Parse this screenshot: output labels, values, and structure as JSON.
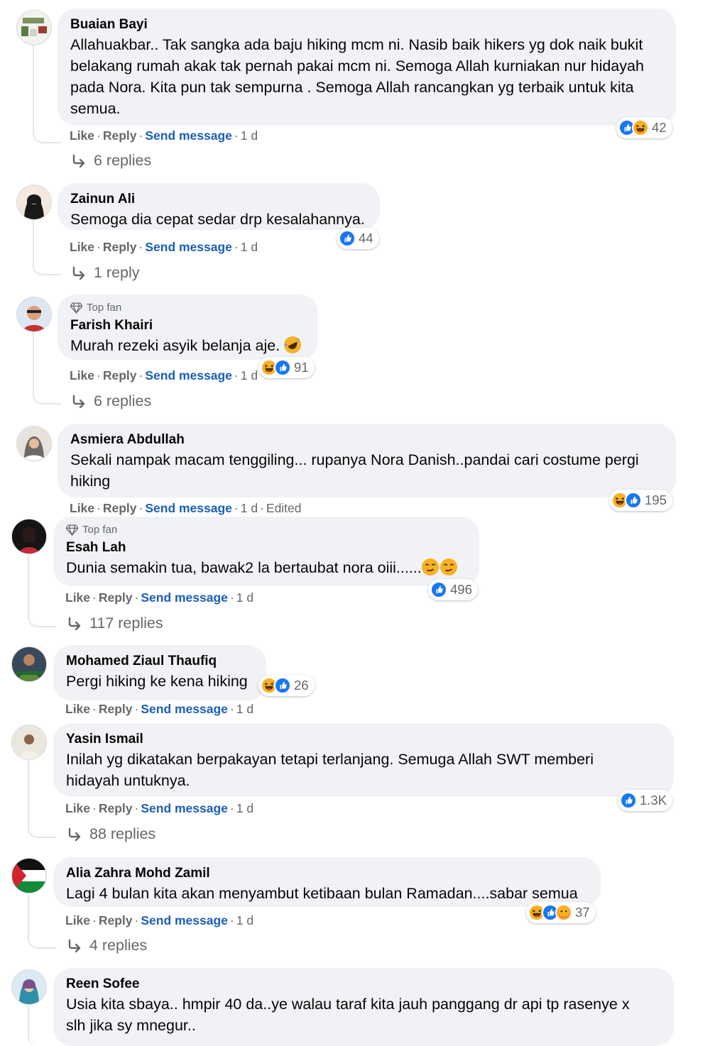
{
  "comments": [
    {
      "author": "Buaian Bayi",
      "top_fan": false,
      "text_lines": [
        "Allahuakbar.. Tak sangka ada baju hiking mcm ni. Nasib baik hikers yg dok naik bukit",
        "belakang rumah akak tak pernah pakai mcm ni. Semoga Allah kurniakan nur hidayah",
        "pada Nora. Kita pun tak sempurna . Semoga Allah rancangkan yg terbaik untuk kita",
        "semua."
      ],
      "like": "Like",
      "reply": "Reply",
      "send": "Send message",
      "time": "1 d",
      "reactions": [
        "like",
        "haha"
      ],
      "reaction_count": "42",
      "replies": "6 replies"
    },
    {
      "author": "Zainun Ali",
      "top_fan": false,
      "text_lines": [
        "Semoga dia cepat sedar drp kesalahannya."
      ],
      "like": "Like",
      "reply": "Reply",
      "send": "Send message",
      "time": "1 d",
      "reactions": [
        "like"
      ],
      "reaction_count": "44",
      "replies": "1 reply"
    },
    {
      "author": "Farish Khairi",
      "top_fan": true,
      "top_fan_label": "Top fan",
      "text_lines": [
        "Murah rezeki asyik belanja aje."
      ],
      "like": "Like",
      "reply": "Reply",
      "send": "Send message",
      "time": "1 d",
      "reactions": [
        "haha",
        "like"
      ],
      "reaction_count": "91",
      "replies": "6 replies"
    },
    {
      "author": "Asmiera Abdullah",
      "top_fan": false,
      "text_lines": [
        "Sekali nampak macam tenggiling... rupanya Nora Danish..pandai cari costume pergi",
        "hiking"
      ],
      "like": "Like",
      "reply": "Reply",
      "send": "Send message",
      "time": "1 d",
      "edited": "Edited",
      "reactions": [
        "haha",
        "like"
      ],
      "reaction_count": "195"
    },
    {
      "author": "Esah Lah",
      "top_fan": true,
      "top_fan_label": "Top fan",
      "text_lines": [
        "Dunia semakin tua, bawak2 la bertaubat nora oiii......"
      ],
      "like": "Like",
      "reply": "Reply",
      "send": "Send message",
      "time": "1 d",
      "reactions": [
        "like"
      ],
      "reaction_count": "496",
      "replies": "117 replies"
    },
    {
      "author": "Mohamed Ziaul Thaufiq",
      "top_fan": false,
      "text_lines": [
        "Pergi hiking ke kena hiking"
      ],
      "like": "Like",
      "reply": "Reply",
      "send": "Send message",
      "time": "1 d",
      "reactions": [
        "haha",
        "like"
      ],
      "reaction_count": "26"
    },
    {
      "author": "Yasin Ismail",
      "top_fan": false,
      "text_lines": [
        "Inilah yg dikatakan berpakayan tetapi terlanjang. Semuga Allah SWT memberi",
        "hidayah untuknya."
      ],
      "like": "Like",
      "reply": "Reply",
      "send": "Send message",
      "time": "1 d",
      "reactions": [
        "like"
      ],
      "reaction_count": "1.3K",
      "replies": "88 replies"
    },
    {
      "author": "Alia Zahra Mohd Zamil",
      "top_fan": false,
      "text_lines": [
        "Lagi 4 bulan kita akan menyambut ketibaan bulan Ramadan....sabar semua"
      ],
      "like": "Like",
      "reply": "Reply",
      "send": "Send message",
      "time": "1 d",
      "reactions": [
        "haha",
        "like",
        "care"
      ],
      "reaction_count": "37",
      "replies": "4 replies"
    },
    {
      "author": "Reen Sofee",
      "top_fan": false,
      "text_lines": [
        "Usia kita sbaya.. hmpir 40 da..ye walau taraf kita jauh panggang dr api tp rasenye x",
        "slh jika sy mnegur.."
      ]
    }
  ],
  "colors": {
    "bubble": "#f0f2f5",
    "send_message": "#1b5eb8",
    "meta": "#65676b",
    "like_blue": "#1877f2",
    "haha_yellow": "#f7b125",
    "care_red": "#f33e58"
  }
}
